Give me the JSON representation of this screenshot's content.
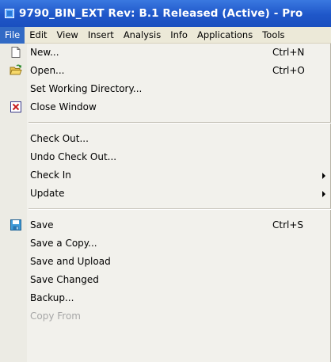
{
  "window": {
    "title": "9790_BIN_EXT Rev: B.1 Released  (Active) - Pro"
  },
  "menubar": {
    "items": [
      "File",
      "Edit",
      "View",
      "Insert",
      "Analysis",
      "Info",
      "Applications",
      "Tools"
    ],
    "active": "File"
  },
  "file_menu": {
    "new": {
      "label": "New...",
      "shortcut": "Ctrl+N",
      "icon": "new-document-icon"
    },
    "open": {
      "label": "Open...",
      "shortcut": "Ctrl+O",
      "icon": "open-folder-icon"
    },
    "set_working_directory": {
      "label": "Set Working Directory..."
    },
    "close_window": {
      "label": "Close Window",
      "icon": "close-window-icon"
    },
    "check_out": {
      "label": "Check Out..."
    },
    "undo_check_out": {
      "label": "Undo Check Out..."
    },
    "check_in": {
      "label": "Check In"
    },
    "update": {
      "label": "Update"
    },
    "save": {
      "label": "Save",
      "shortcut": "Ctrl+S",
      "icon": "save-icon"
    },
    "save_a_copy": {
      "label": "Save a Copy..."
    },
    "save_and_upload": {
      "label": "Save and Upload"
    },
    "save_changed": {
      "label": "Save Changed"
    },
    "backup": {
      "label": "Backup..."
    },
    "copy_from": {
      "label": "Copy From",
      "enabled": false
    }
  },
  "colors": {
    "titlebar": "#1f57c9",
    "menubar": "#ece9d8",
    "menu_background": "#f2f1ec",
    "highlight": "#316ac5",
    "disabled_text": "#a7a7a7"
  }
}
